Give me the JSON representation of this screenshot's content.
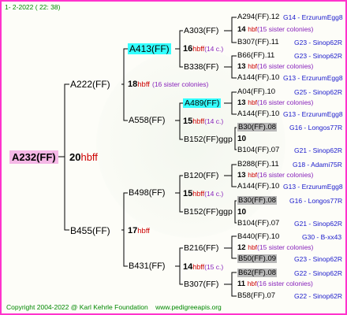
{
  "header": {
    "text": "1-  2-2022 ( 22: 38)"
  },
  "footer": {
    "copyright": "Copyright 2004-2022 @ Karl Kehrle Foundation",
    "website": "www.pedigreeapis.org"
  },
  "root": {
    "code": "A232(FF)",
    "num": "20",
    "suffix": "hbff"
  },
  "gen2": [
    {
      "code": "A222(FF)",
      "num": "18",
      "suffix": "hbff",
      "note": "(16 sister colonies)"
    },
    {
      "code": "B455(FF)",
      "num": "17",
      "suffix": "hbff"
    }
  ],
  "gen3": [
    {
      "code": "A413(FF)",
      "num": "16",
      "suffix": "hbff",
      "note": "(14 c.)"
    },
    {
      "code": "A558(FF)",
      "num": "15",
      "suffix": "hbff",
      "note": "(14 c.)"
    },
    {
      "code": "B498(FF)",
      "num": "15",
      "suffix": "hbff",
      "note": "(14 c.)"
    },
    {
      "code": "B431(FF)",
      "num": "14",
      "suffix": "hbff",
      "note": "(15 c.)"
    }
  ],
  "gen4": [
    {
      "code": "A303(FF)"
    },
    {
      "code": "B338(FF)"
    },
    {
      "code": "A489(FF)"
    },
    {
      "code": "B152(FF)ggp"
    },
    {
      "code": "B120(FF)"
    },
    {
      "code": "B152(FF)ggp"
    },
    {
      "code": "B216(FF)"
    },
    {
      "code": "B307(FF)"
    }
  ],
  "gen5": [
    {
      "code": "A294(FF).12",
      "src": "G14 - ErzurumEgg8",
      "mid_num": "14",
      "mid_suffix": "hbf",
      "mid_note": "(15 sister colonies)",
      "code2": "B307(FF).11",
      "src2": "G23 - Sinop62R"
    },
    {
      "code": "B66(FF).11",
      "src": "G23 - Sinop62R",
      "mid_num": "13",
      "mid_suffix": "hbf",
      "mid_note": "(16 sister colonies)",
      "code2": "A144(FF).10",
      "src2": "G13 - ErzurumEgg8"
    },
    {
      "code": "A04(FF).10",
      "src": "G25 - Sinop62R",
      "mid_num": "13",
      "mid_suffix": "hbf",
      "mid_note": "(16 sister colonies)",
      "code2": "A144(FF).10",
      "src2": "G13 - ErzurumEgg8"
    },
    {
      "code": "B30(FF).08",
      "src": "G16 - Longos77R",
      "mid_num": "10",
      "mid_suffix": "",
      "mid_note": "",
      "code2": "B104(FF).07",
      "src2": "G21 - Sinop62R"
    },
    {
      "code": "B288(FF).11",
      "src": "G18 - Adami75R",
      "mid_num": "13",
      "mid_suffix": "hbf",
      "mid_note": "(16 sister colonies)",
      "code2": "A144(FF).10",
      "src2": "G13 - ErzurumEgg8"
    },
    {
      "code": "B30(FF).08",
      "src": "G16 - Longos77R",
      "mid_num": "10",
      "mid_suffix": "",
      "mid_note": "",
      "code2": "B104(FF).07",
      "src2": "G21 - Sinop62R"
    },
    {
      "code": "B440(FF).10",
      "src": "G30 - B-xx43",
      "mid_num": "12",
      "mid_suffix": "hbf",
      "mid_note": "(15 sister colonies)",
      "code2": "B50(FF).09",
      "src2": "G23 - Sinop62R"
    },
    {
      "code": "B62(FF).08",
      "src": "G22 - Sinop62R",
      "mid_num": "11",
      "mid_suffix": "hbf",
      "mid_note": "(16 sister colonies)",
      "code2": "B58(FF).07",
      "src2": "G22 - Sinop62R"
    }
  ]
}
